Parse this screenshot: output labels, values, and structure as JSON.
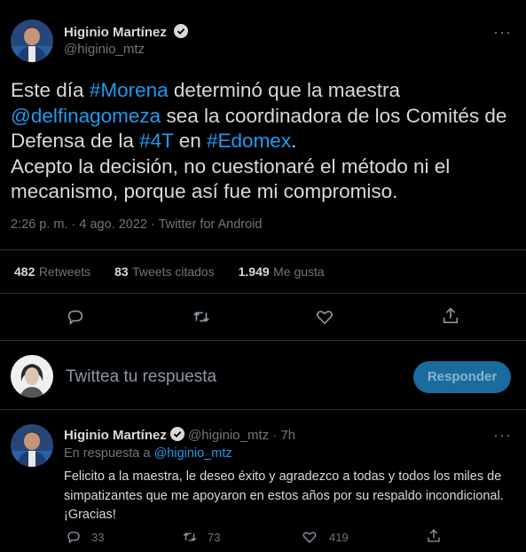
{
  "main_tweet": {
    "author_name": "Higinio Martínez",
    "author_handle": "@higinio_mtz",
    "text_parts": [
      {
        "text": "Este día ",
        "link": false
      },
      {
        "text": "#Morena",
        "link": true
      },
      {
        "text": " determinó que la maestra ",
        "link": false
      },
      {
        "text": "@delfinagomeza",
        "link": true
      },
      {
        "text": " sea la coordinadora de los Comités de Defensa de la ",
        "link": false
      },
      {
        "text": "#4T",
        "link": true
      },
      {
        "text": " en ",
        "link": false
      },
      {
        "text": "#Edomex",
        "link": true
      },
      {
        "text": ".",
        "link": false
      }
    ],
    "text_line2": "Acepto la decisión, no cuestionaré el método ni el mecanismo, porque así fue mi compromiso.",
    "timestamp": "2:26 p. m. · 4 ago. 2022 · Twitter for Android",
    "stats": {
      "retweets_num": "482",
      "retweets_label": "Retweets",
      "quotes_num": "83",
      "quotes_label": "Tweets citados",
      "likes_num": "1.949",
      "likes_label": "Me gusta"
    }
  },
  "composer": {
    "placeholder": "Twittea tu respuesta",
    "button_label": "Responder"
  },
  "reply_tweet": {
    "author_name": "Higinio Martínez",
    "author_handle": "@higinio_mtz",
    "time": "· 7h",
    "reply_to_prefix": "En respuesta a",
    "reply_to_handle": "@higinio_mtz",
    "text": "Felicito a la maestra, le deseo éxito y agradezco a todas y todos los miles de simpatizantes que me apoyaron en estos años por su respaldo incondicional. ¡Gracias!",
    "replies": "33",
    "retweets": "73",
    "likes": "419"
  },
  "more_glyph": "···",
  "icons": [
    "verified-badge-icon",
    "more-icon",
    "reply-icon",
    "retweet-icon",
    "like-icon",
    "share-icon"
  ],
  "colors": {
    "accent": "#1d9bf0",
    "background": "#000000",
    "divider": "#2f3336",
    "muted": "#6e767d"
  }
}
